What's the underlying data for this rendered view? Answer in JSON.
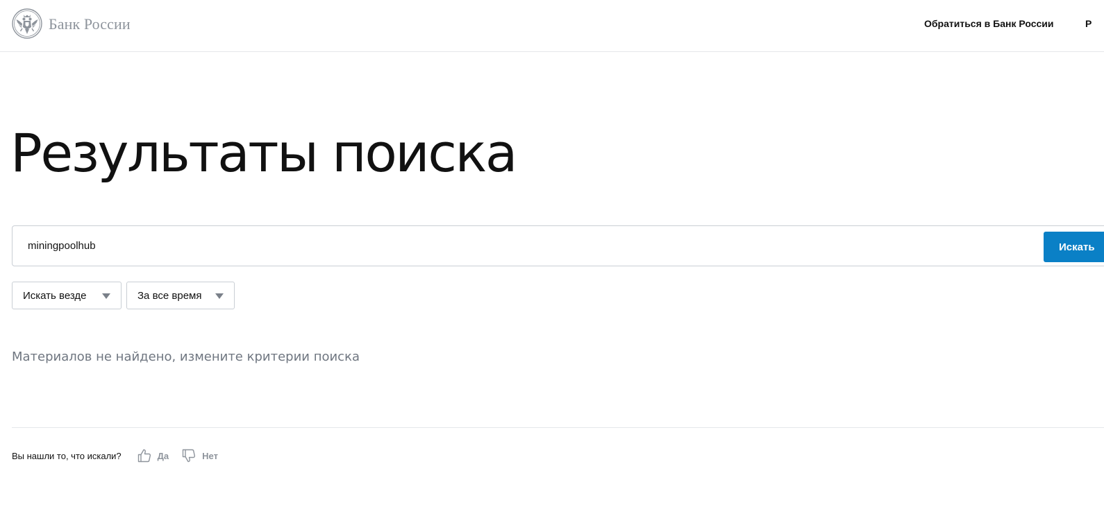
{
  "header": {
    "logo_text": "Банк России",
    "logo_icon": "double-headed-eagle-emblem",
    "nav": [
      {
        "label": "Обратиться в Банк России"
      },
      {
        "label": "Р"
      }
    ]
  },
  "page": {
    "title": "Результаты поиска"
  },
  "search": {
    "query": "miningpoolhub",
    "button_label": "Искать"
  },
  "filters": [
    {
      "label": "Искать везде",
      "icon": "chevron-down-icon"
    },
    {
      "label": "За все время",
      "icon": "chevron-down-icon"
    }
  ],
  "results": {
    "empty_message": "Материалов не найдено, измените критерии поиска"
  },
  "feedback": {
    "question": "Вы нашли то, что искали?",
    "yes_label": "Да",
    "yes_icon": "thumbs-up-icon",
    "no_label": "Нет",
    "no_icon": "thumbs-down-icon"
  },
  "colors": {
    "accent": "#0a80c6",
    "muted_text": "#6f7680",
    "logo_gray": "#8e949c",
    "border": "#c9ced4"
  }
}
